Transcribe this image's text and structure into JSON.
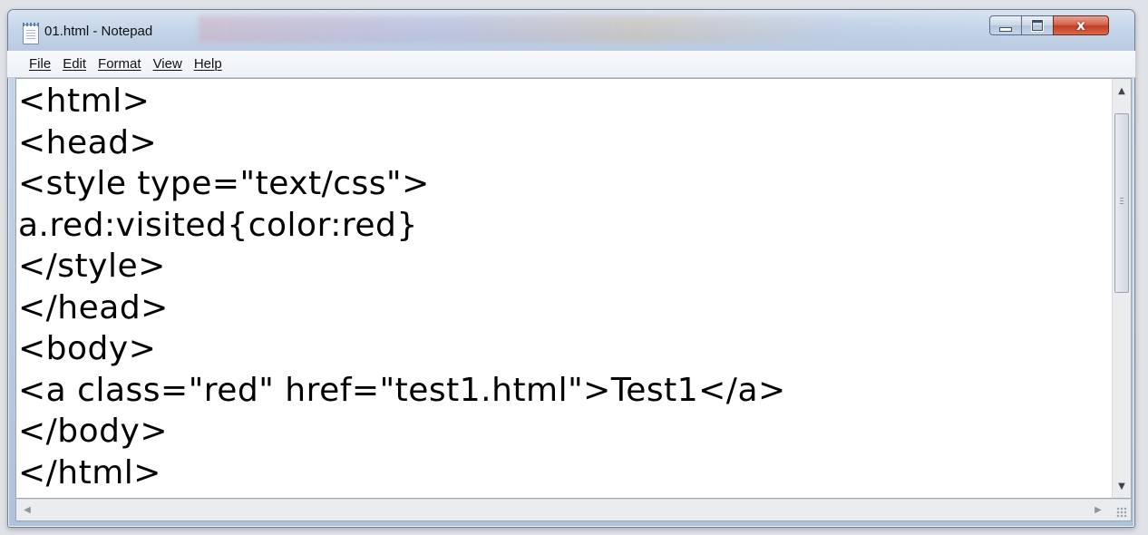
{
  "window": {
    "title": "01.html - Notepad",
    "close_glyph": "x",
    "icons": {
      "app": "notepad-icon",
      "minimize": "minimize-icon",
      "maximize": "maximize-icon",
      "close": "close-icon"
    }
  },
  "menu": [
    {
      "label": "File"
    },
    {
      "label": "Edit"
    },
    {
      "label": "Format"
    },
    {
      "label": "View"
    },
    {
      "label": "Help"
    }
  ],
  "editor": {
    "lines": [
      "<html>",
      "<head>",
      "<style type=\"text/css\">",
      "a.red:visited{color:red}",
      "</style>",
      "</head>",
      "<body>",
      "<a class=\"red\" href=\"test1.html\">Test1</a>",
      "</body>",
      "</html>"
    ]
  },
  "scrollbars": {
    "vertical_position": 0.0,
    "horizontal_position": 0.0
  },
  "colors": {
    "title_bar": "#c5d5e9",
    "close_button": "#c43d22",
    "editor_background": "#ffffff",
    "text": "#000000"
  }
}
